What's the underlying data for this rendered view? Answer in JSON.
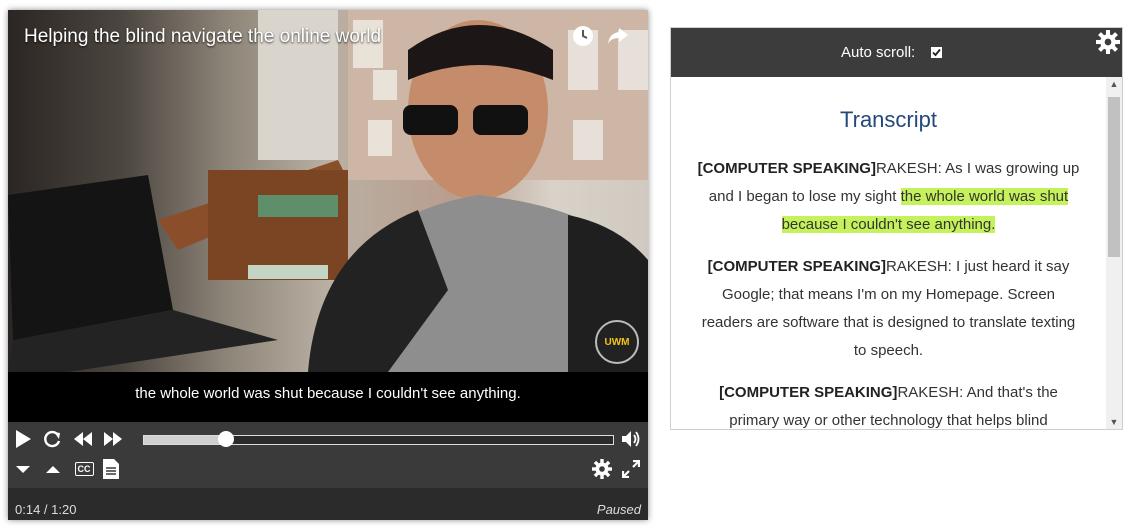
{
  "player": {
    "title": "Helping the blind navigate the online world",
    "caption": "the whole world was shut because I couldn't see anything.",
    "time": "0:14 / 1:20",
    "state": "Paused",
    "progress_fraction": 0.175,
    "logo_text": "UWM",
    "cc_label": "CC",
    "icons": {
      "watch_later": "clock-icon",
      "share": "share-icon",
      "play": "play-icon",
      "restart": "restart-icon",
      "rewind": "rewind-icon",
      "fast_forward": "fast-forward-icon",
      "volume": "volume-icon",
      "slower": "chevron-down-icon",
      "faster": "chevron-up-icon",
      "captions": "captions-icon",
      "transcript": "transcript-icon",
      "settings": "gear-icon",
      "fullscreen": "fullscreen-icon"
    }
  },
  "transcript": {
    "autoscroll_label": "Auto scroll:",
    "autoscroll_checked": true,
    "heading": "Transcript",
    "entries": [
      {
        "speaker": "[COMPUTER SPEAKING]",
        "text_before": "RAKESH: As I was growing up and I began to lose my sight ",
        "highlight": "the whole world was shut because I couldn't see anything.",
        "text_after": ""
      },
      {
        "speaker": "[COMPUTER SPEAKING]",
        "text_before": "RAKESH: I just heard it say Google; that means I'm on my Homepage. Screen readers are software that is designed to translate texting to speech.",
        "highlight": "",
        "text_after": ""
      },
      {
        "speaker": "[COMPUTER SPEAKING]",
        "text_before": "RAKESH: And that's the primary way or other technology that helps blind",
        "highlight": "",
        "text_after": ""
      }
    ]
  },
  "colors": {
    "highlight": "#c5f25b",
    "heading": "#24487a",
    "control_bar": "#3a3a3a"
  }
}
